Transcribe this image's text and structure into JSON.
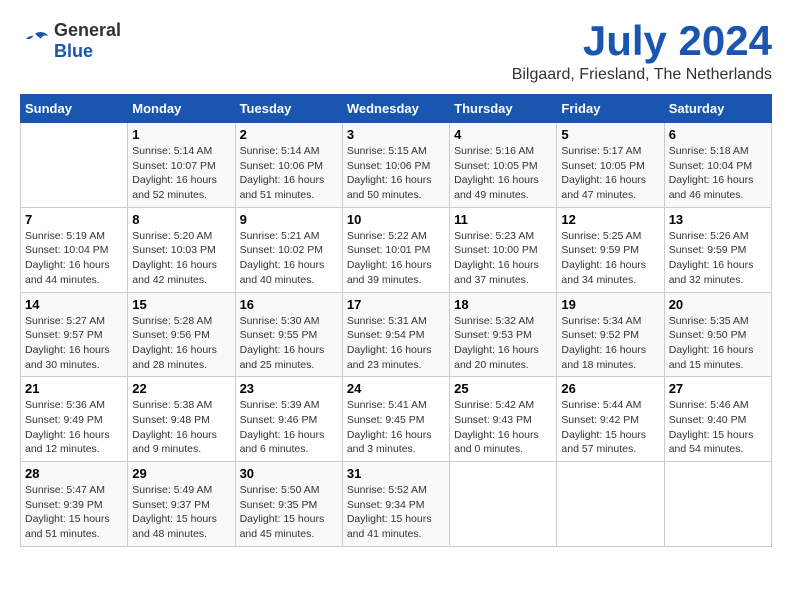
{
  "header": {
    "logo_general": "General",
    "logo_blue": "Blue",
    "month_title": "July 2024",
    "location": "Bilgaard, Friesland, The Netherlands"
  },
  "calendar": {
    "days_of_week": [
      "Sunday",
      "Monday",
      "Tuesday",
      "Wednesday",
      "Thursday",
      "Friday",
      "Saturday"
    ],
    "weeks": [
      [
        {
          "day": "",
          "info": ""
        },
        {
          "day": "1",
          "info": "Sunrise: 5:14 AM\nSunset: 10:07 PM\nDaylight: 16 hours\nand 52 minutes."
        },
        {
          "day": "2",
          "info": "Sunrise: 5:14 AM\nSunset: 10:06 PM\nDaylight: 16 hours\nand 51 minutes."
        },
        {
          "day": "3",
          "info": "Sunrise: 5:15 AM\nSunset: 10:06 PM\nDaylight: 16 hours\nand 50 minutes."
        },
        {
          "day": "4",
          "info": "Sunrise: 5:16 AM\nSunset: 10:05 PM\nDaylight: 16 hours\nand 49 minutes."
        },
        {
          "day": "5",
          "info": "Sunrise: 5:17 AM\nSunset: 10:05 PM\nDaylight: 16 hours\nand 47 minutes."
        },
        {
          "day": "6",
          "info": "Sunrise: 5:18 AM\nSunset: 10:04 PM\nDaylight: 16 hours\nand 46 minutes."
        }
      ],
      [
        {
          "day": "7",
          "info": "Sunrise: 5:19 AM\nSunset: 10:04 PM\nDaylight: 16 hours\nand 44 minutes."
        },
        {
          "day": "8",
          "info": "Sunrise: 5:20 AM\nSunset: 10:03 PM\nDaylight: 16 hours\nand 42 minutes."
        },
        {
          "day": "9",
          "info": "Sunrise: 5:21 AM\nSunset: 10:02 PM\nDaylight: 16 hours\nand 40 minutes."
        },
        {
          "day": "10",
          "info": "Sunrise: 5:22 AM\nSunset: 10:01 PM\nDaylight: 16 hours\nand 39 minutes."
        },
        {
          "day": "11",
          "info": "Sunrise: 5:23 AM\nSunset: 10:00 PM\nDaylight: 16 hours\nand 37 minutes."
        },
        {
          "day": "12",
          "info": "Sunrise: 5:25 AM\nSunset: 9:59 PM\nDaylight: 16 hours\nand 34 minutes."
        },
        {
          "day": "13",
          "info": "Sunrise: 5:26 AM\nSunset: 9:59 PM\nDaylight: 16 hours\nand 32 minutes."
        }
      ],
      [
        {
          "day": "14",
          "info": "Sunrise: 5:27 AM\nSunset: 9:57 PM\nDaylight: 16 hours\nand 30 minutes."
        },
        {
          "day": "15",
          "info": "Sunrise: 5:28 AM\nSunset: 9:56 PM\nDaylight: 16 hours\nand 28 minutes."
        },
        {
          "day": "16",
          "info": "Sunrise: 5:30 AM\nSunset: 9:55 PM\nDaylight: 16 hours\nand 25 minutes."
        },
        {
          "day": "17",
          "info": "Sunrise: 5:31 AM\nSunset: 9:54 PM\nDaylight: 16 hours\nand 23 minutes."
        },
        {
          "day": "18",
          "info": "Sunrise: 5:32 AM\nSunset: 9:53 PM\nDaylight: 16 hours\nand 20 minutes."
        },
        {
          "day": "19",
          "info": "Sunrise: 5:34 AM\nSunset: 9:52 PM\nDaylight: 16 hours\nand 18 minutes."
        },
        {
          "day": "20",
          "info": "Sunrise: 5:35 AM\nSunset: 9:50 PM\nDaylight: 16 hours\nand 15 minutes."
        }
      ],
      [
        {
          "day": "21",
          "info": "Sunrise: 5:36 AM\nSunset: 9:49 PM\nDaylight: 16 hours\nand 12 minutes."
        },
        {
          "day": "22",
          "info": "Sunrise: 5:38 AM\nSunset: 9:48 PM\nDaylight: 16 hours\nand 9 minutes."
        },
        {
          "day": "23",
          "info": "Sunrise: 5:39 AM\nSunset: 9:46 PM\nDaylight: 16 hours\nand 6 minutes."
        },
        {
          "day": "24",
          "info": "Sunrise: 5:41 AM\nSunset: 9:45 PM\nDaylight: 16 hours\nand 3 minutes."
        },
        {
          "day": "25",
          "info": "Sunrise: 5:42 AM\nSunset: 9:43 PM\nDaylight: 16 hours\nand 0 minutes."
        },
        {
          "day": "26",
          "info": "Sunrise: 5:44 AM\nSunset: 9:42 PM\nDaylight: 15 hours\nand 57 minutes."
        },
        {
          "day": "27",
          "info": "Sunrise: 5:46 AM\nSunset: 9:40 PM\nDaylight: 15 hours\nand 54 minutes."
        }
      ],
      [
        {
          "day": "28",
          "info": "Sunrise: 5:47 AM\nSunset: 9:39 PM\nDaylight: 15 hours\nand 51 minutes."
        },
        {
          "day": "29",
          "info": "Sunrise: 5:49 AM\nSunset: 9:37 PM\nDaylight: 15 hours\nand 48 minutes."
        },
        {
          "day": "30",
          "info": "Sunrise: 5:50 AM\nSunset: 9:35 PM\nDaylight: 15 hours\nand 45 minutes."
        },
        {
          "day": "31",
          "info": "Sunrise: 5:52 AM\nSunset: 9:34 PM\nDaylight: 15 hours\nand 41 minutes."
        },
        {
          "day": "",
          "info": ""
        },
        {
          "day": "",
          "info": ""
        },
        {
          "day": "",
          "info": ""
        }
      ]
    ]
  }
}
